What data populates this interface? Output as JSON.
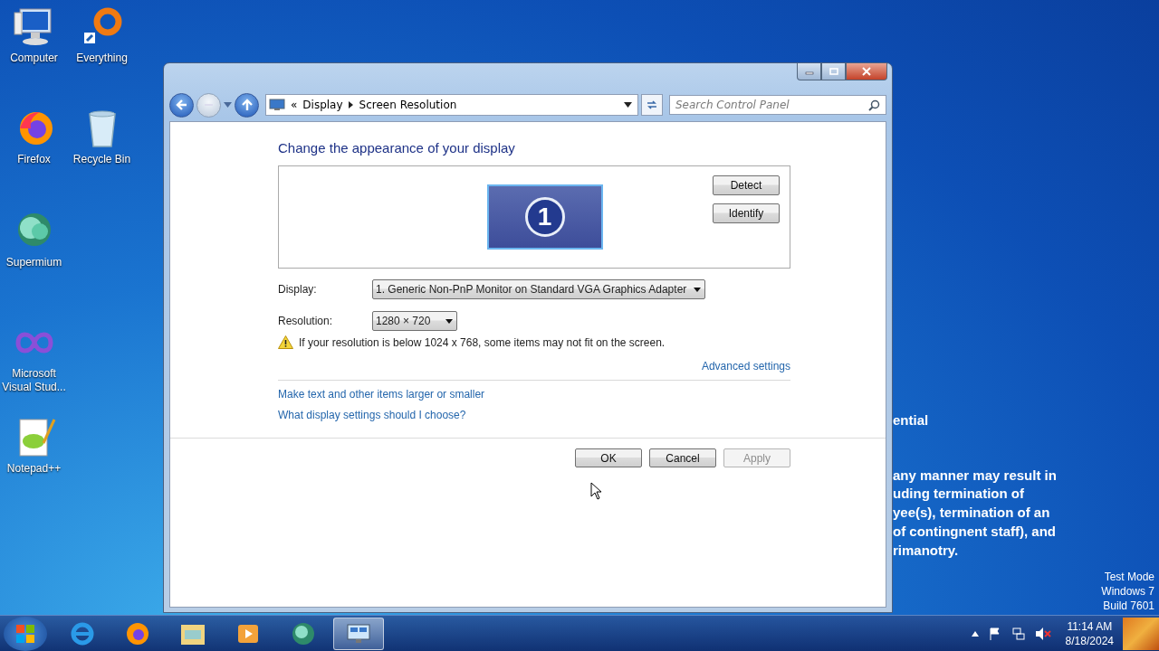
{
  "desktop_icons": [
    {
      "label": "Computer",
      "kind": "computer"
    },
    {
      "label": "Everything",
      "kind": "ring"
    },
    {
      "label": "Firefox",
      "kind": "fox"
    },
    {
      "label": "Recycle Bin",
      "kind": "bin"
    },
    {
      "label": "Supermium",
      "kind": "globe"
    },
    {
      "label": "Microsoft Visual Stud...",
      "kind": "infinity"
    },
    {
      "label": "Notepad++",
      "kind": "notepad"
    }
  ],
  "wallpaper_text": [
    "ential",
    "any manner may result in",
    "uding termination of",
    "yee(s), termination of an",
    "of contingnent staff), and",
    "rimanotry."
  ],
  "watermark": [
    "Test Mode",
    "Windows 7",
    "Build 7601"
  ],
  "window": {
    "address_bar": {
      "overflow": "«",
      "breadcrumbs": [
        "Display",
        "Screen Resolution"
      ],
      "search_placeholder": "Search Control Panel"
    },
    "heading": "Change the appearance of your display",
    "monitor_number": "1",
    "side_buttons": [
      "Detect",
      "Identify"
    ],
    "fields": [
      {
        "label": "Display:",
        "value": "1. Generic Non-PnP Monitor on Standard VGA Graphics Adapter"
      },
      {
        "label": "Resolution:",
        "value": "1280 × 720"
      }
    ],
    "warning": "If your resolution is below 1024 x 768, some items may not fit on the screen.",
    "advanced_link": "Advanced settings",
    "links": [
      "Make text and other items larger or smaller",
      "What display settings should I choose?"
    ],
    "buttons": [
      {
        "label": "OK",
        "disabled": false
      },
      {
        "label": "Cancel",
        "disabled": false
      },
      {
        "label": "Apply",
        "disabled": true
      }
    ]
  },
  "taskbar": {
    "apps": [
      {
        "kind": "ie",
        "selected": false
      },
      {
        "kind": "fox",
        "selected": false
      },
      {
        "kind": "folder",
        "selected": false
      },
      {
        "kind": "media",
        "selected": false
      },
      {
        "kind": "globe",
        "selected": false
      },
      {
        "kind": "display",
        "selected": true
      }
    ],
    "time": "11:14 AM",
    "date": "8/18/2024"
  }
}
